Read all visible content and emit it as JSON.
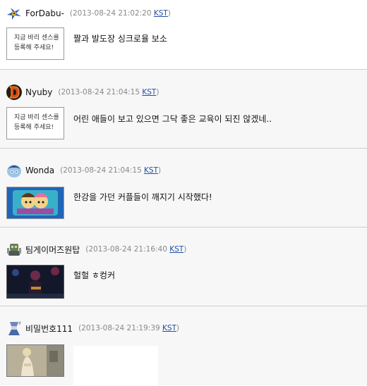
{
  "posts": [
    {
      "username": "ForDabu-",
      "time_open": "(2013-08-24 21:02:20 ",
      "tz": "KST",
      "time_close": ")",
      "avatar_icon": "bird-icon",
      "thumb_type": "placeholder",
      "placeholder_line1": "지금 바리 센스를",
      "placeholder_line2": "등록해 주세요!",
      "message": "짤과 발도장 싱크로율 보소"
    },
    {
      "username": "Nyuby",
      "time_open": "(2013-08-24 21:04:15 ",
      "tz": "KST",
      "time_close": ")",
      "avatar_icon": "diablo-d-icon",
      "thumb_type": "placeholder",
      "placeholder_line1": "지금 바리 센스를",
      "placeholder_line2": "등록해 주세요!",
      "message": "어린 애들이 보고 있으면 그닥 좋은 교육이 되진 않겠네.."
    },
    {
      "username": "Wonda",
      "time_open": "(2013-08-24 21:04:15 ",
      "tz": "KST",
      "time_close": ")",
      "avatar_icon": "cartoon-head-icon",
      "thumb_type": "cartoon",
      "message": "한강을 가던 커플들이 깨지기 시작했다!"
    },
    {
      "username": "팀게이머즈원탑",
      "time_open": "(2013-08-24 21:16:40 ",
      "tz": "KST",
      "time_close": ")",
      "avatar_icon": "robot-icon",
      "thumb_type": "stage",
      "message": "헐헐 ㅎ컹커"
    },
    {
      "username": "비밀번호111",
      "time_open": "(2013-08-24 21:19:39 ",
      "tz": "KST",
      "time_close": ")",
      "avatar_icon": "warrior-icon",
      "thumb_type": "photo",
      "message": ""
    }
  ]
}
